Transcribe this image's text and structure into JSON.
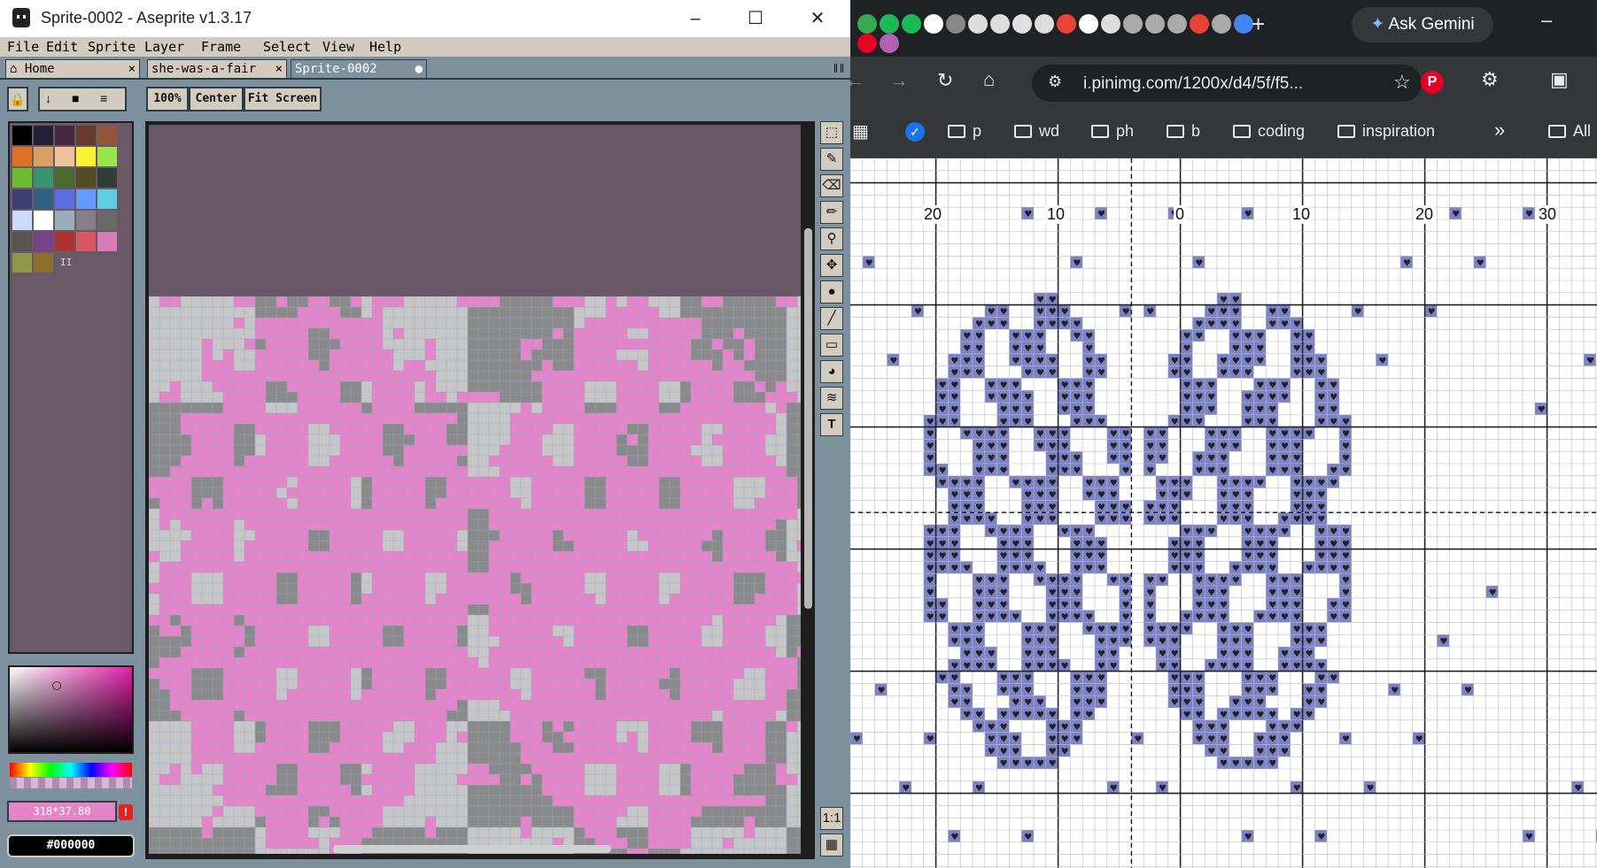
{
  "aseprite": {
    "title": "Sprite-0002 - Aseprite v1.3.17",
    "menu": [
      "File",
      "Edit",
      "Sprite",
      "Layer",
      "Frame",
      "Select",
      "View",
      "Help"
    ],
    "tabs": [
      {
        "label": "Home",
        "close": "×"
      },
      {
        "label": "she-was-a-fair",
        "close": "×"
      },
      {
        "label": "Sprite-0002",
        "close": "●"
      }
    ],
    "zoom_buttons": [
      "100%",
      "Center",
      "Fit Screen"
    ],
    "coords": "318*37.80",
    "warning": "!",
    "hex": "#000000",
    "palette_marker": "II",
    "palette": [
      "#000000",
      "#222034",
      "#45283c",
      "#663931",
      "#8f563b",
      "#df7126",
      "#d9a066",
      "#eec39a",
      "#fbf236",
      "#99e550",
      "#6abe30",
      "#37946e",
      "#4b692f",
      "#524b24",
      "#323c39",
      "#3f3f74",
      "#306082",
      "#5b6ee1",
      "#639bff",
      "#5fcde4",
      "#cbdbfc",
      "#ffffff",
      "#9badb7",
      "#847e87",
      "#696a6a",
      "#595652",
      "#76428a",
      "#ac3232",
      "#d95763",
      "#d77bba",
      "#8f974a",
      "#8a6f30"
    ]
  },
  "chrome": {
    "url": "i.pinimg.com/1200x/d4/5f/f5...",
    "gemini": "Ask Gemini",
    "favicons": [
      "#34a853",
      "#1db954",
      "#1db954",
      "#fff",
      "#888",
      "#ddd",
      "#ddd",
      "#e0e0e0",
      "#ddd",
      "#ea4335",
      "#fff",
      "#ddd",
      "#aaa",
      "#aaa",
      "#aaa",
      "#ea4335",
      "#aaa",
      "#4285f4",
      "#e60023",
      "#b55fb5"
    ],
    "bookmarks": [
      "p",
      "wd",
      "ph",
      "b",
      "coding",
      "inspiration"
    ],
    "bookmark_more": "»",
    "bookmark_all": "All",
    "ruler_labels": [
      "20",
      "10",
      "0",
      "10",
      "20",
      "30"
    ]
  }
}
